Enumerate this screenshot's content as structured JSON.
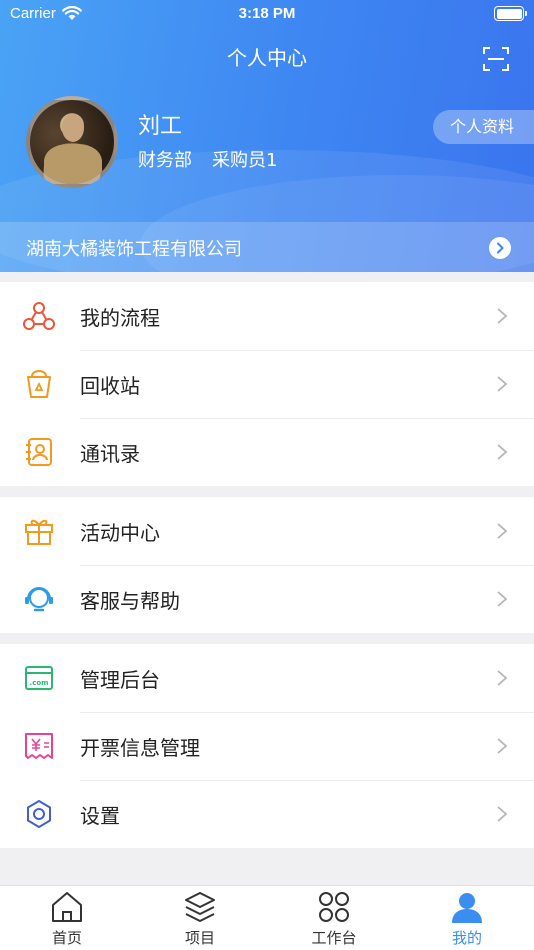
{
  "status_bar": {
    "carrier": "Carrier",
    "time": "3:18 PM"
  },
  "header": {
    "title": "个人中心"
  },
  "user": {
    "name": "刘工",
    "department": "财务部",
    "role": "采购员1",
    "profile_button": "个人资料"
  },
  "company": {
    "name": "湖南大橘装饰工程有限公司"
  },
  "menu": {
    "workflow": "我的流程",
    "recycle": "回收站",
    "contacts": "通讯录",
    "activity": "活动中心",
    "support": "客服与帮助",
    "admin": "管理后台",
    "invoice": "开票信息管理",
    "settings": "设置"
  },
  "tabs": {
    "home": "首页",
    "project": "项目",
    "workbench": "工作台",
    "mine": "我的"
  },
  "icons": {
    "workflow": "workflow-icon",
    "recycle": "recycle-bin-icon",
    "contacts": "contacts-icon",
    "activity": "gift-icon",
    "support": "headset-icon",
    "admin": "admin-dotcom-icon",
    "invoice": "invoice-yen-icon",
    "settings": "gear-icon"
  },
  "colors": {
    "accent": "#3a8ef0",
    "header_start": "#4aa3f5",
    "header_end": "#3a74ee"
  }
}
